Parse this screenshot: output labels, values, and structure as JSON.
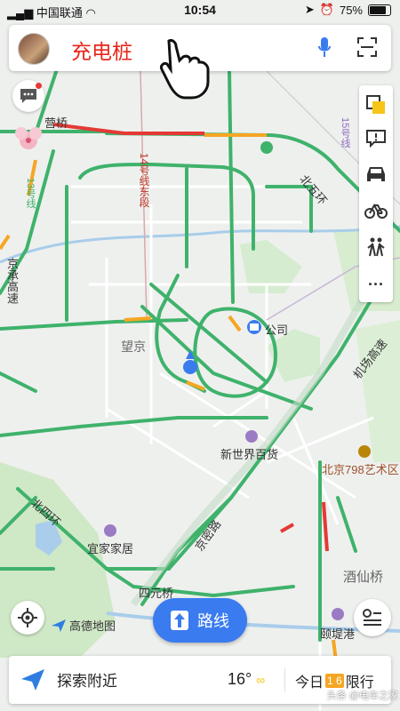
{
  "status": {
    "carrier": "中国联通",
    "time": "10:54",
    "battery": "75%"
  },
  "search": {
    "query": "充电桩"
  },
  "map_labels": {
    "bridge": "营桥",
    "line13": "13号线",
    "line14": "14号线东段",
    "line15": "15号线",
    "ring5": "北五环",
    "jingcheng": "京承高速",
    "wangjing": "望京",
    "company": "公司",
    "airport": "机场高速",
    "xinshijie": "新世界百货",
    "art798": "北京798艺术区",
    "ring4": "北四环",
    "jingmi": "京密路",
    "ikea": "宜家家居",
    "siyuan": "四元桥",
    "jiuxian": "酒仙桥",
    "yitigang": "颐堤港"
  },
  "tools": [
    "layers",
    "feedback",
    "car",
    "bike",
    "walk",
    "more"
  ],
  "logo": {
    "text": "高德地图"
  },
  "route_button": {
    "label": "路线"
  },
  "bottom_bar": {
    "explore_label": "探索附近",
    "temperature": "16°",
    "today_label": "今日",
    "plate_numbers": "1 6",
    "restriction_label": "限行"
  },
  "watermark": "头条 @电车之家",
  "colors": {
    "accent": "#3a7bf0",
    "road_green": "#3fb26b",
    "road_red": "#e53935",
    "road_orange": "#f5a623"
  }
}
